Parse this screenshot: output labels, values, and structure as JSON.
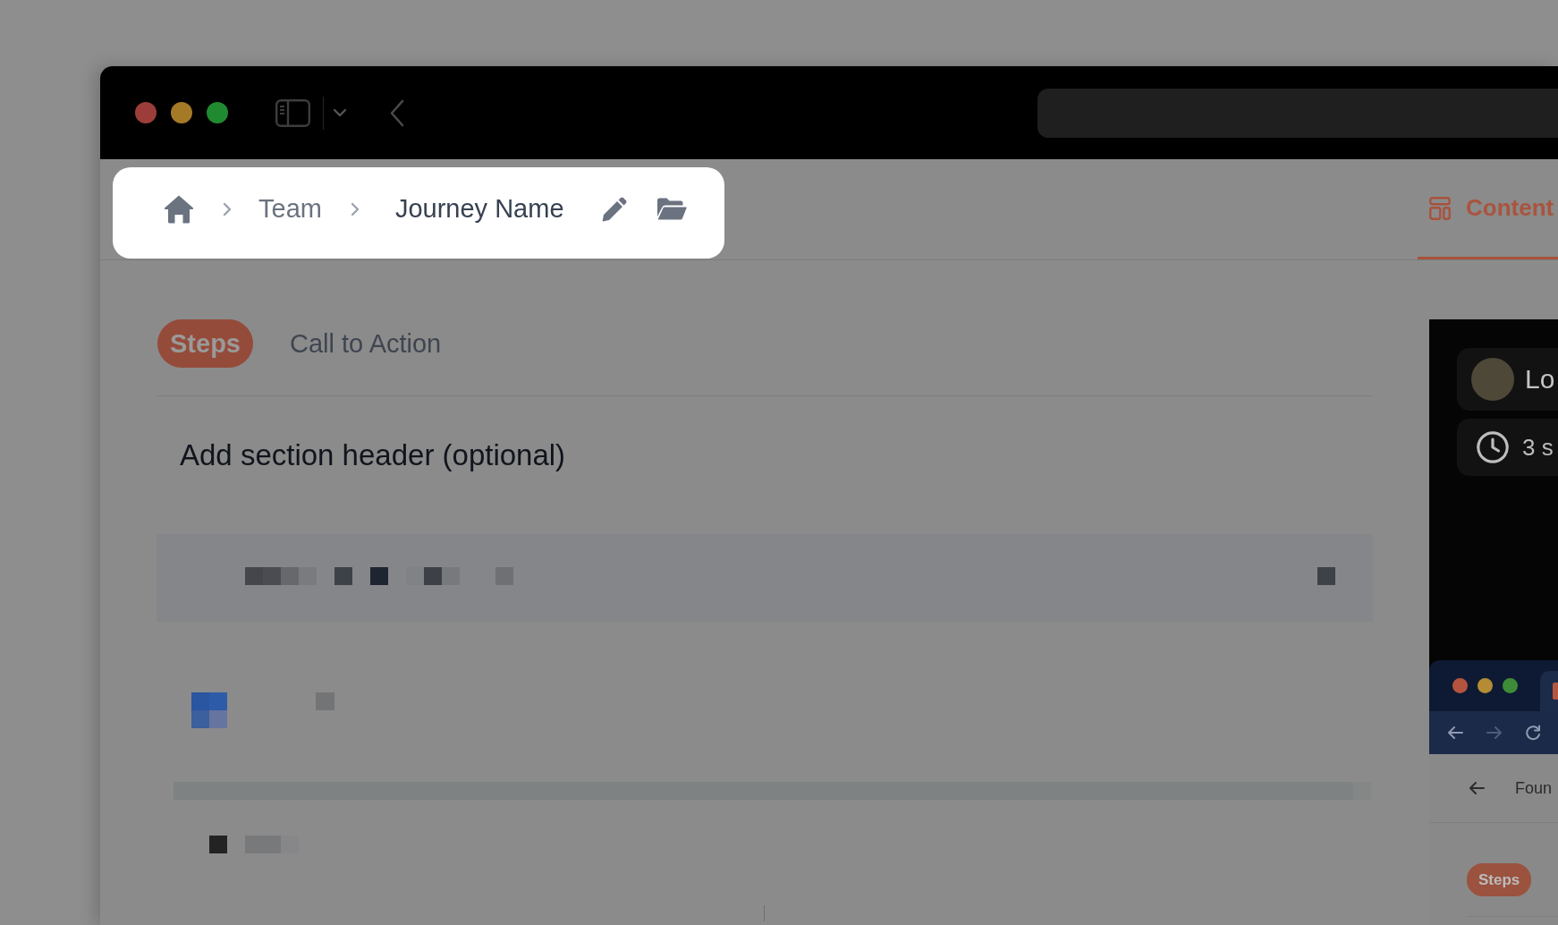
{
  "breadcrumb": {
    "items": [
      {
        "label": "Team",
        "current": false
      },
      {
        "label": "Journey Name",
        "current": true
      }
    ]
  },
  "header_tabs": [
    {
      "label": "Content",
      "selected": true
    }
  ],
  "editor": {
    "tabs": [
      {
        "label": "Steps",
        "selected": true
      },
      {
        "label": "Call to Action",
        "selected": false
      }
    ],
    "section_header": {
      "placeholder": "Add section header (optional)"
    }
  },
  "preview": {
    "author": {
      "name": "Lo"
    },
    "duration": "3 s",
    "browser": {
      "page_title": "Foun",
      "tabs": [
        {
          "label": "Steps",
          "selected": true
        }
      ]
    }
  }
}
